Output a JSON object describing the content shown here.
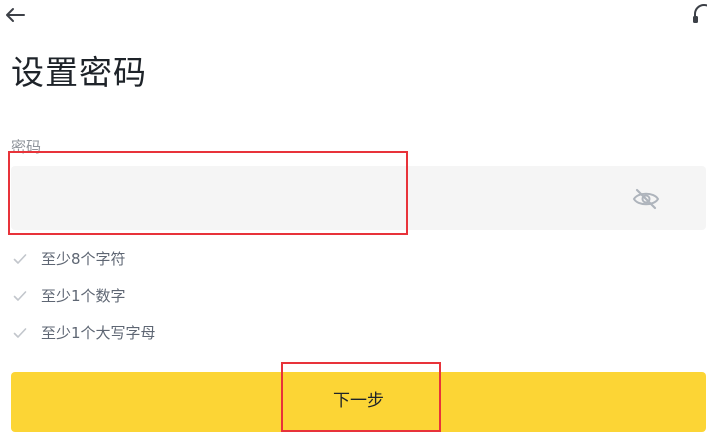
{
  "header": {
    "back_icon": "arrow-left-icon",
    "support_icon": "headset-icon"
  },
  "page": {
    "title": "设置密码"
  },
  "password": {
    "label": "密码",
    "value": "",
    "placeholder": "",
    "visibility_icon": "eye-off-icon"
  },
  "rules": [
    {
      "text": "至少8个字符",
      "icon": "check-icon"
    },
    {
      "text": "至少1个数字",
      "icon": "check-icon"
    },
    {
      "text": "至少1个大写字母",
      "icon": "check-icon"
    }
  ],
  "actions": {
    "next_label": "下一步"
  },
  "colors": {
    "accent": "#fcd535",
    "highlight": "#e8333a",
    "input_bg": "#f5f5f5",
    "muted_text": "#8f949b"
  }
}
